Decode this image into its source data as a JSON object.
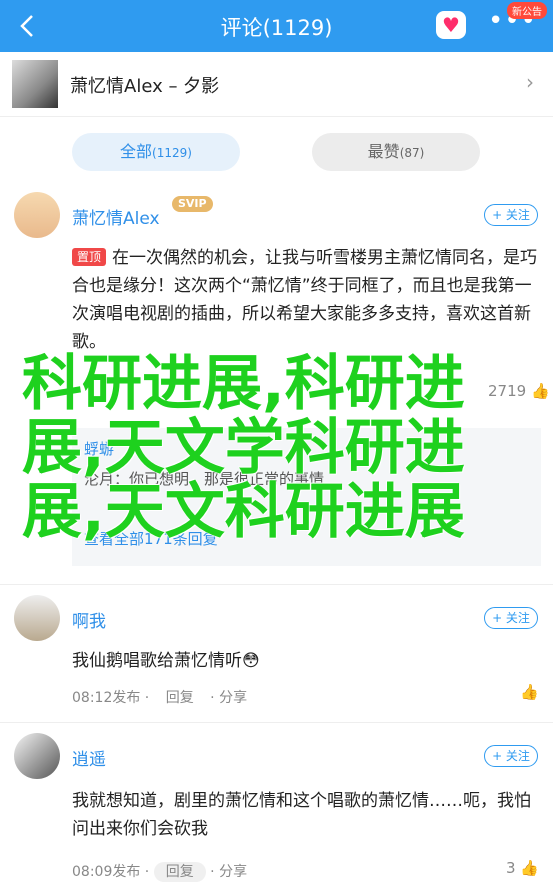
{
  "header": {
    "title": "评论(1129)",
    "new_badge": "新公告"
  },
  "song": {
    "label": "萧忆情Alex – 夕影"
  },
  "tabs": [
    {
      "label": "全部",
      "count": "(1129)"
    },
    {
      "label": "最赞",
      "count": "(87)"
    }
  ],
  "comments": [
    {
      "user": "萧忆情Alex",
      "badge": "SVIP",
      "pin": "置顶",
      "text": "在一次偶然的机会，让我与听雪楼男主萧忆情同名，是巧合也是缘分！这次两个“萧忆情”终于同框了，而且也是我第一次演唱电视剧的插曲，所以希望大家能多多支持，喜欢这首新歌。",
      "likes": "2719",
      "follow": "+ 关注",
      "reply_user1": "蜉蝣",
      "reply_text": "沦月：你已想明，那是很正常的事情",
      "view_all": "查看全部171条回复"
    },
    {
      "user": "啊我",
      "text": "我仙鹅唱歌给萧忆情听😳",
      "time": "08:12发布",
      "reply": "回复",
      "share": "分享",
      "follow": "+ 关注"
    },
    {
      "user": "逍遥",
      "text": "我就想知道，剧里的萧忆情和这个唱歌的萧忆情……呃，我怕问出来你们会砍我",
      "time": "08:09发布",
      "reply": "回复",
      "share": "分享",
      "likes": "3",
      "follow": "+ 关注"
    }
  ],
  "watermark": "科研进展,科研进展,天文学科研进展,天文科研进展",
  "colors": {
    "accent": "#2f9bf0",
    "watermark": "#1ed11e",
    "pin": "#f04848"
  }
}
